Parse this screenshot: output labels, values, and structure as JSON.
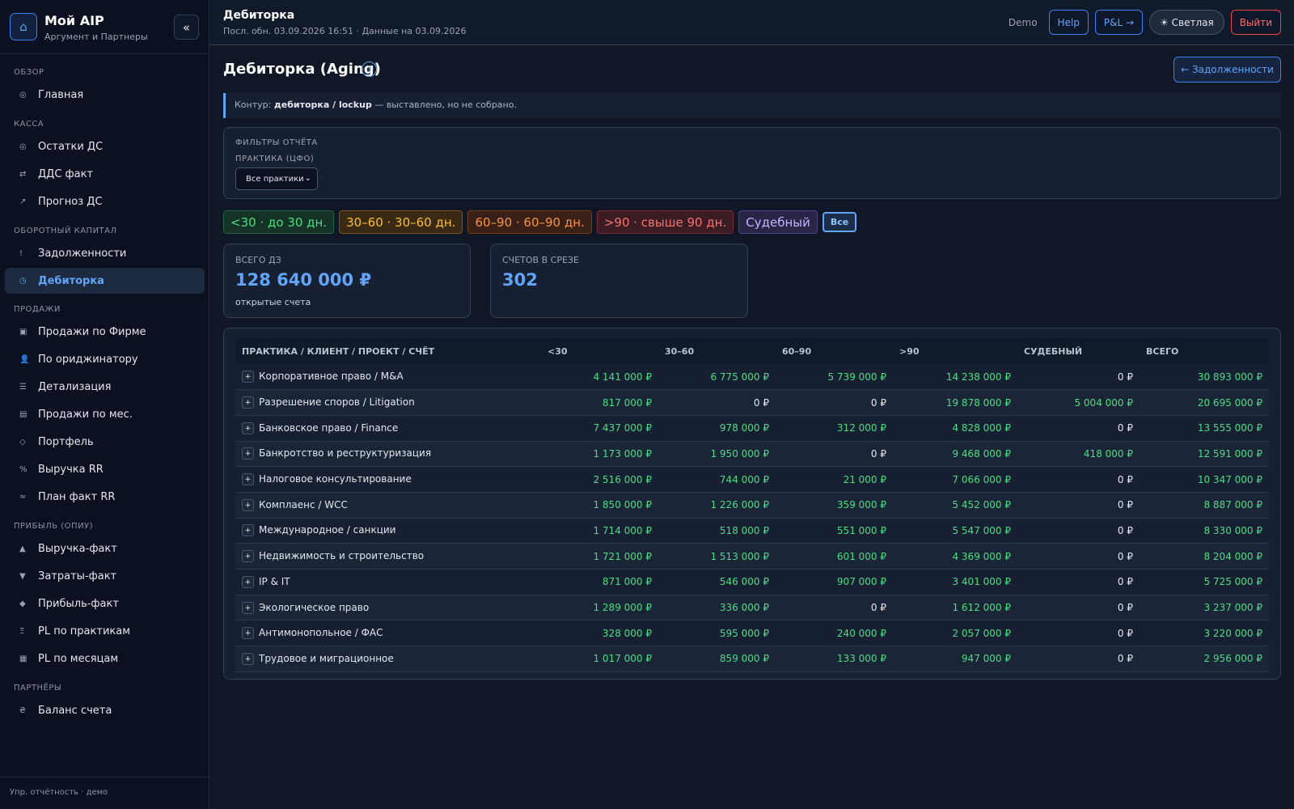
{
  "sidebar": {
    "brand_icon": "home-icon",
    "brand_title": "Мой AIP",
    "brand_sub": "Аргумент и Партнеры",
    "collapse": "«",
    "sections": [
      {
        "title": "ОБЗОР"
      },
      {
        "title": "КАССА"
      },
      {
        "title": "ОБОРОТНЫЙ КАПИТАЛ"
      },
      {
        "title": "ПРОДАЖИ"
      },
      {
        "title": "ПРИБЫЛЬ (ОПИУ)"
      },
      {
        "title": "ПАРТНЁРЫ"
      }
    ],
    "items": [
      {
        "icon": "◎",
        "label": "Главная"
      },
      {
        "icon": "◎",
        "label": "Остатки ДС"
      },
      {
        "icon": "⇄",
        "label": "ДДС факт"
      },
      {
        "icon": "↗",
        "label": "Прогноз ДС"
      },
      {
        "icon": "!",
        "label": "Задолженности"
      },
      {
        "icon": "◷",
        "label": "Дебиторка",
        "active": true
      },
      {
        "icon": "▣",
        "label": "Продажи по Фирме"
      },
      {
        "icon": "👤",
        "label": "По ориджинатору"
      },
      {
        "icon": "☰",
        "label": "Детализация"
      },
      {
        "icon": "▤",
        "label": "Продажи по мес."
      },
      {
        "icon": "◇",
        "label": "Портфель"
      },
      {
        "icon": "%",
        "label": "Выручка RR"
      },
      {
        "icon": "≈",
        "label": "План факт RR"
      },
      {
        "icon": "▲",
        "label": "Выручка-факт"
      },
      {
        "icon": "▼",
        "label": "Затраты-факт"
      },
      {
        "icon": "◆",
        "label": "Прибыль-факт"
      },
      {
        "icon": "Ξ",
        "label": "PL по практикам"
      },
      {
        "icon": "▦",
        "label": "PL по месяцам"
      },
      {
        "icon": "₴",
        "label": "Баланс счета"
      }
    ],
    "footer": "Упр. отчётность · демо"
  },
  "header": {
    "title": "Дебиторка",
    "subtitle": "Посл. обн. 03.09.2026 16:51 · Данные на 03.09.2026",
    "demo": "Demo",
    "help": "Help",
    "pl": "P&L →",
    "theme": "☀ Светлая",
    "logout": "Выйти"
  },
  "main": {
    "title": "Дебиторка (Aging)",
    "help_icon": "?",
    "back_button": "← Задолженности",
    "contour_prefix": "Контур: ",
    "contour_bold": "дебиторка / lockup",
    "contour_suffix": " — выставлено, но не собрано.",
    "filters_title": "ФИЛЬТРЫ ОТЧЁТА",
    "practice_label": "ПРАКТИКА (ЦФО)",
    "practice_value": "Все практики",
    "chips": [
      {
        "label": "<30 · до 30 дн.",
        "color": "#4ade80"
      },
      {
        "label": "30–60 · 30–60 дн.",
        "color": "#fbbf24"
      },
      {
        "label": "60–90 · 60–90 дн.",
        "color": "#fb923c"
      },
      {
        "label": ">90 · свыше 90 дн.",
        "color": "#f87171"
      },
      {
        "label": "Судебный",
        "color": "#c4b5fd"
      },
      {
        "label": "Все",
        "color": "#93c5fd"
      }
    ],
    "kpis": [
      {
        "label": "ВСЕГО ДЗ",
        "value": "128 640 000 ₽",
        "sub": "открытые счета"
      },
      {
        "label": "СЧЕТОВ В СРЕЗЕ",
        "value": "302",
        "sub": ""
      }
    ]
  },
  "table": {
    "headers": [
      "ПРАКТИКА / КЛИЕНТ / ПРОЕКТ / СЧЁТ",
      "<30",
      "30–60",
      "60–90",
      ">90",
      "СУДЕБНЫЙ",
      "ВСЕГО"
    ],
    "expand_symbol": "+",
    "rows": [
      [
        "Корпоративное право / M&A",
        "4 141 000 ₽",
        "6 775 000 ₽",
        "5 739 000 ₽",
        "14 238 000 ₽",
        "0 ₽",
        "30 893 000 ₽"
      ],
      [
        "Разрешение споров / Litigation",
        "817 000 ₽",
        "0 ₽",
        "0 ₽",
        "19 878 000 ₽",
        "5 004 000 ₽",
        "20 695 000 ₽"
      ],
      [
        "Банковское право / Finance",
        "7 437 000 ₽",
        "978 000 ₽",
        "312 000 ₽",
        "4 828 000 ₽",
        "0 ₽",
        "13 555 000 ₽"
      ],
      [
        "Банкротство и реструктуризация",
        "1 173 000 ₽",
        "1 950 000 ₽",
        "0 ₽",
        "9 468 000 ₽",
        "418 000 ₽",
        "12 591 000 ₽"
      ],
      [
        "Налоговое консультирование",
        "2 516 000 ₽",
        "744 000 ₽",
        "21 000 ₽",
        "7 066 000 ₽",
        "0 ₽",
        "10 347 000 ₽"
      ],
      [
        "Комплаенс / WCC",
        "1 850 000 ₽",
        "1 226 000 ₽",
        "359 000 ₽",
        "5 452 000 ₽",
        "0 ₽",
        "8 887 000 ₽"
      ],
      [
        "Международное / санкции",
        "1 714 000 ₽",
        "518 000 ₽",
        "551 000 ₽",
        "5 547 000 ₽",
        "0 ₽",
        "8 330 000 ₽"
      ],
      [
        "Недвижимость и строительство",
        "1 721 000 ₽",
        "1 513 000 ₽",
        "601 000 ₽",
        "4 369 000 ₽",
        "0 ₽",
        "8 204 000 ₽"
      ],
      [
        "IP & IT",
        "871 000 ₽",
        "546 000 ₽",
        "907 000 ₽",
        "3 401 000 ₽",
        "0 ₽",
        "5 725 000 ₽"
      ],
      [
        "Экологическое право",
        "1 289 000 ₽",
        "336 000 ₽",
        "0 ₽",
        "1 612 000 ₽",
        "0 ₽",
        "3 237 000 ₽"
      ],
      [
        "Антимонопольное / ФАС",
        "328 000 ₽",
        "595 000 ₽",
        "240 000 ₽",
        "2 057 000 ₽",
        "0 ₽",
        "3 220 000 ₽"
      ],
      [
        "Трудовое и миграционное",
        "1 017 000 ₽",
        "859 000 ₽",
        "133 000 ₽",
        "947 000 ₽",
        "0 ₽",
        "2 956 000 ₽"
      ]
    ]
  }
}
